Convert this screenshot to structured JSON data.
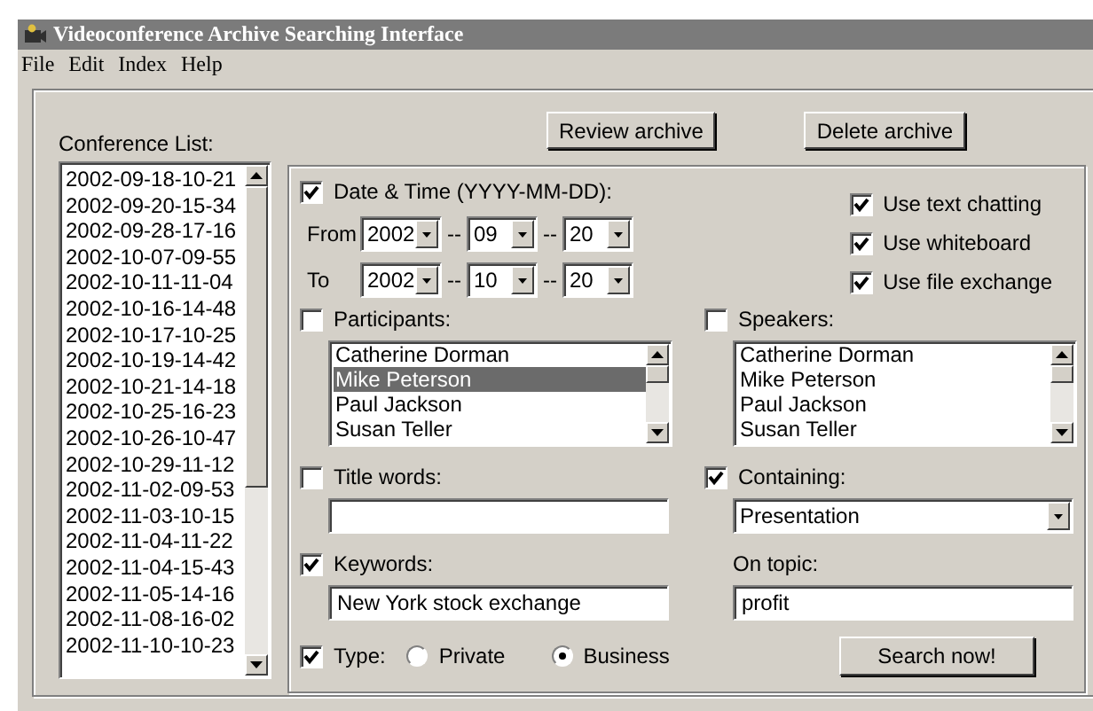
{
  "window": {
    "title": "Videoconference Archive Searching Interface"
  },
  "menu": [
    "File",
    "Edit",
    "Index",
    "Help"
  ],
  "conference_list": {
    "label": "Conference List:",
    "items": [
      "2002-09-18-10-21",
      "2002-09-20-15-34",
      "2002-09-28-17-16",
      "2002-10-07-09-55",
      "2002-10-11-11-04",
      "2002-10-16-14-48",
      "2002-10-17-10-25",
      "2002-10-19-14-42",
      "2002-10-21-14-18",
      "2002-10-25-16-23",
      "2002-10-26-10-47",
      "2002-10-29-11-12",
      "2002-11-02-09-53",
      "2002-11-03-10-15",
      "2002-11-04-11-22",
      "2002-11-04-15-43",
      "2002-11-05-14-16",
      "2002-11-08-16-02",
      "2002-11-10-10-23"
    ]
  },
  "buttons": [
    {
      "label": "Review archive"
    },
    {
      "label": "Delete archive"
    }
  ],
  "date_time": {
    "label": "Date & Time (YYYY-MM-DD):",
    "checked": true,
    "ranges": [
      {
        "label": "From",
        "year": "2002",
        "month": "09",
        "day": "20"
      },
      {
        "label": "To",
        "year": "2002",
        "month": "10",
        "day": "20"
      }
    ],
    "separator": "--"
  },
  "options": [
    {
      "label": "Use text chatting",
      "checked": true
    },
    {
      "label": "Use whiteboard",
      "checked": true
    },
    {
      "label": "Use file exchange",
      "checked": true
    }
  ],
  "participants": {
    "label": "Participants:",
    "checked": false,
    "items": [
      {
        "name": "Catherine Dorman",
        "selected": false
      },
      {
        "name": "Mike Peterson",
        "selected": true
      },
      {
        "name": "Paul Jackson",
        "selected": false
      },
      {
        "name": "Susan Teller",
        "selected": false
      }
    ]
  },
  "speakers": {
    "label": "Speakers:",
    "checked": false,
    "items": [
      {
        "name": "Catherine Dorman",
        "selected": false
      },
      {
        "name": "Mike Peterson",
        "selected": false
      },
      {
        "name": "Paul Jackson",
        "selected": false
      },
      {
        "name": "Susan Teller",
        "selected": false
      }
    ]
  },
  "title_words": {
    "label": "Title words:",
    "checked": false
  },
  "containing": {
    "label": "Containing:",
    "checked": true,
    "value": "Presentation"
  },
  "keywords": {
    "label": "Keywords:",
    "checked": true,
    "value": "New York stock exchange"
  },
  "on_topic": {
    "label": "On topic:",
    "value": "profit"
  },
  "type": {
    "label": "Type:",
    "checked": true,
    "options": [
      {
        "label": "Private",
        "selected": false
      },
      {
        "label": "Business",
        "selected": true
      }
    ]
  },
  "search_button": {
    "label": "Search now!"
  }
}
